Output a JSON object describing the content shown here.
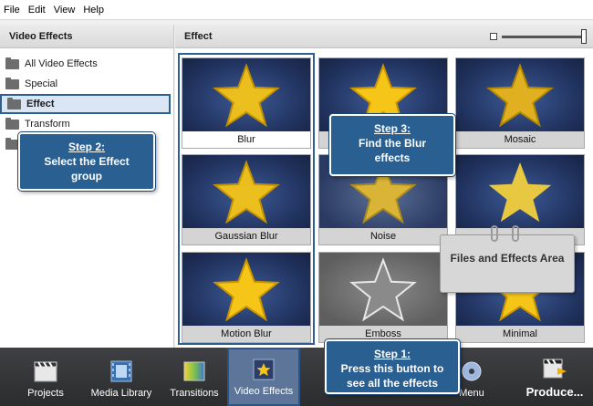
{
  "menu": [
    "File",
    "Edit",
    "View",
    "Help"
  ],
  "left_panel": {
    "title": "Video Effects",
    "items": [
      {
        "label": "All Video Effects"
      },
      {
        "label": "Special"
      },
      {
        "label": "Effect",
        "selected": true
      },
      {
        "label": "Transform"
      },
      {
        "label": ""
      }
    ]
  },
  "right_panel": {
    "title": "Effect",
    "zoom_level": 0.95,
    "effects": [
      {
        "label": "Blur",
        "style": "blur",
        "selected": true
      },
      {
        "label": "",
        "style": "clear"
      },
      {
        "label": "Mosaic",
        "style": "mosaic"
      },
      {
        "label": "Gaussian Blur",
        "style": "blur"
      },
      {
        "label": "Noise",
        "style": "noise"
      },
      {
        "label": "",
        "style": "sparkle"
      },
      {
        "label": "Motion Blur",
        "style": "clear"
      },
      {
        "label": "Emboss",
        "style": "emboss"
      },
      {
        "label": "Minimal",
        "style": "clear"
      }
    ]
  },
  "toolbar": {
    "buttons": [
      {
        "label": "Projects",
        "icon": "clapperboard-icon"
      },
      {
        "label": "Media Library",
        "icon": "film-icon"
      },
      {
        "label": "Transitions",
        "icon": "transition-icon"
      },
      {
        "label": "Video Effects",
        "icon": "star-effect-icon",
        "active": true
      },
      {
        "label": "Menu",
        "icon": "disc-icon"
      },
      {
        "label": "Produce...",
        "icon": "produce-icon"
      }
    ]
  },
  "callouts": {
    "step1": {
      "title": "Step 1:",
      "text": "Press this button to see all the effects"
    },
    "step2": {
      "title": "Step 2:",
      "text": "Select the Effect group"
    },
    "step3": {
      "title": "Step 3:",
      "text": "Find the Blur effects"
    },
    "files_area": "Files and Effects Area"
  },
  "colors": {
    "accent": "#2a5f92",
    "toolbar_bg": "#3f4043",
    "star": "#f5c518"
  }
}
